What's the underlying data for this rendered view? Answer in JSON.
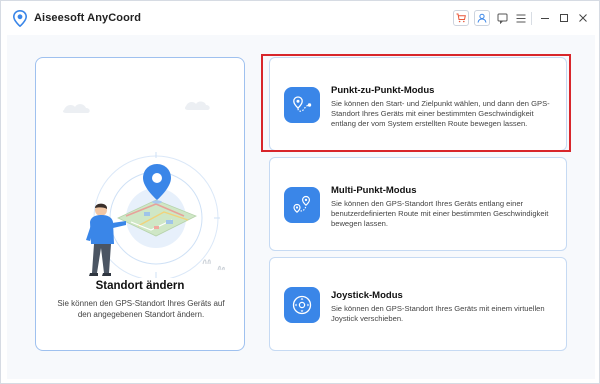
{
  "window": {
    "title": "Aiseesoft AnyCoord",
    "controls": [
      "cart-icon",
      "user-icon",
      "feedback-icon",
      "menu-icon",
      "minimize-icon",
      "maximize-icon",
      "close-icon"
    ]
  },
  "colors": {
    "accent": "#3a86e8",
    "card_border": "#9fc1ef",
    "highlight": "#d8262b",
    "cart": "#e8573a"
  },
  "main_card": {
    "title": "Standort ändern",
    "description": "Sie können den GPS-Standort Ihres Geräts auf den angegebenen Standort ändern."
  },
  "modes": [
    {
      "title": "Punkt-zu-Punkt-Modus",
      "description": "Sie können den Start- und Zielpunkt wählen, und dann den GPS-Standort Ihres Geräts mit einer bestimmten Geschwindigkeit entlang der vom System erstellten Route bewegen lassen.",
      "icon": "route-pin-icon"
    },
    {
      "title": "Multi-Punkt-Modus",
      "description": "Sie können den GPS-Standort Ihres Geräts entlang einer benutzerdefinierten Route mit einer bestimmten Geschwindigkeit bewegen lassen.",
      "icon": "multi-pin-icon"
    },
    {
      "title": "Joystick-Modus",
      "description": "Sie können den GPS-Standort Ihres Geräts mit einem virtuellen Joystick verschieben.",
      "icon": "joystick-icon"
    }
  ]
}
